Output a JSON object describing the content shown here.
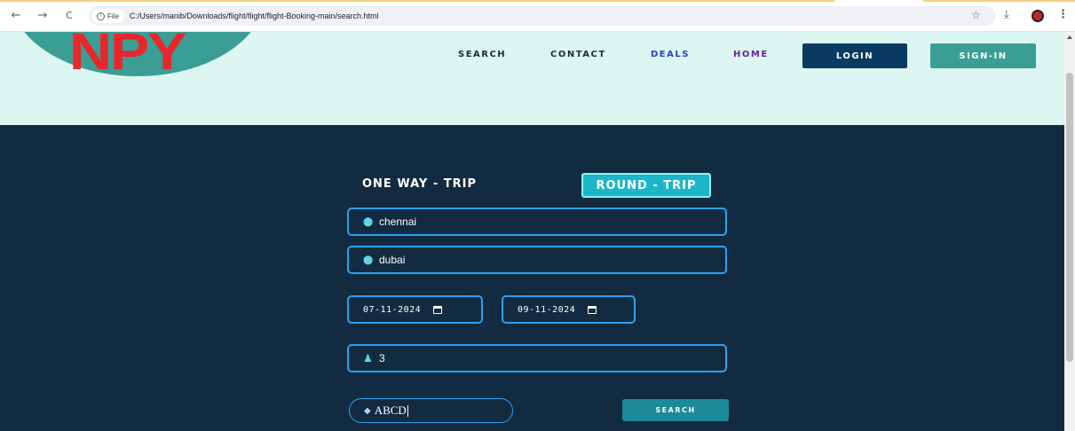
{
  "browser": {
    "back_icon": "←",
    "forward_icon": "→",
    "reload_icon": "C",
    "file_label": "File",
    "url": "C:/Users/manib/Downloads/flight/flight/flight-Booking-main/search.html",
    "star_icon": "☆",
    "download_icon": "⤓",
    "menu_icon": "⋮"
  },
  "header": {
    "logo_text": "NPY",
    "nav": [
      {
        "label": "SEARCH",
        "color": "#1e2b38"
      },
      {
        "label": "CONTACT",
        "color": "#1e2b38"
      },
      {
        "label": "DEALS",
        "color": "#2f3bd6"
      },
      {
        "label": "HOME",
        "color": "#6a1fa8"
      }
    ],
    "login_label": "LOGIN",
    "signin_label": "SIGN-IN"
  },
  "search": {
    "oneway_label": "ONE WAY - TRIP",
    "round_label": "ROUND - TRIP",
    "from_value": "chennai",
    "to_value": "dubai",
    "depart_date": "07-11-2024",
    "return_date": "09-11-2024",
    "passengers": "3",
    "promo_value": "ABCD",
    "search_label": "SEARCH"
  },
  "colors": {
    "header_bg": "#dcf6f1",
    "main_bg": "#132b40",
    "accent": "#2aa2ee",
    "teal": "#3a9e95",
    "login_bg": "#083a62"
  }
}
